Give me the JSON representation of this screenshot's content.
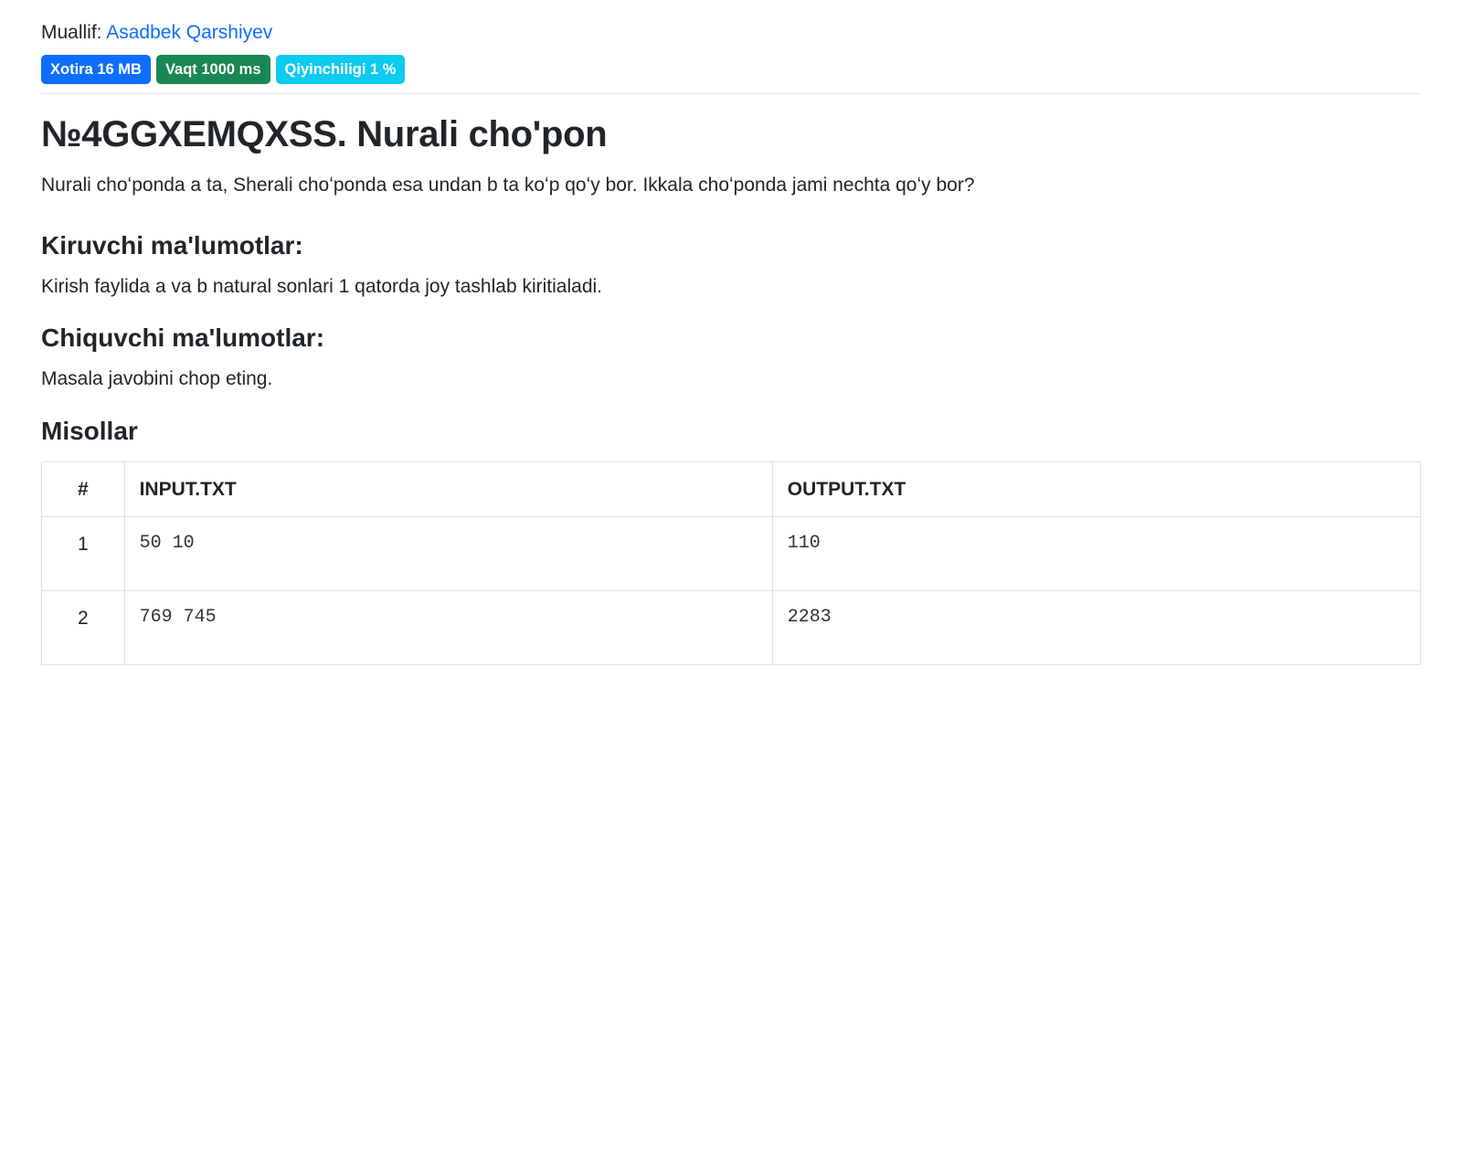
{
  "author": {
    "label": "Muallif:",
    "name": "Asadbek Qarshiyev"
  },
  "badges": {
    "memory": "Xotira 16 MB",
    "time": "Vaqt 1000 ms",
    "difficulty": "Qiyinchiligi 1 %"
  },
  "problem": {
    "title": "№4GGXEMQXSS. Nurali cho'pon",
    "description": "Nurali choʻponda a ta, Sherali choʻponda esa undan b ta koʻp qoʻy bor. Ikkala choʻponda jami nechta qoʻy bor?"
  },
  "input_section": {
    "heading": "Kiruvchi ma'lumotlar:",
    "text": "Kirish faylida a va b natural sonlari 1 qatorda joy tashlab kiritialadi."
  },
  "output_section": {
    "heading": "Chiquvchi ma'lumotlar:",
    "text": "Masala javobini chop eting."
  },
  "examples": {
    "heading": "Misollar",
    "headers": {
      "num": "#",
      "input": "INPUT.TXT",
      "output": "OUTPUT.TXT"
    },
    "rows": [
      {
        "num": "1",
        "input": "50 10",
        "output": "110"
      },
      {
        "num": "2",
        "input": "769 745",
        "output": "2283"
      }
    ]
  }
}
